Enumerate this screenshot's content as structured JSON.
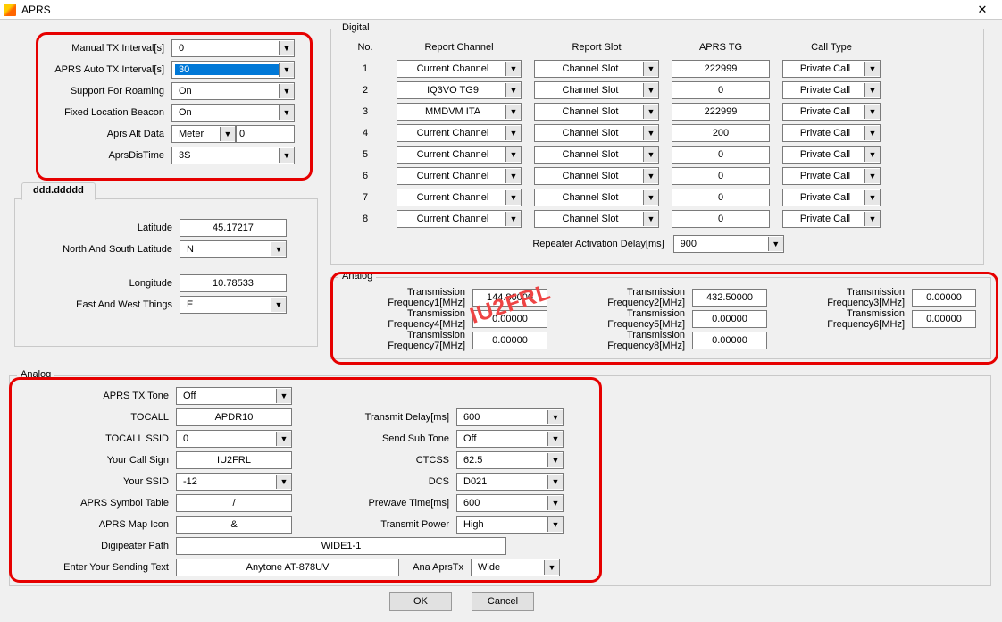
{
  "window": {
    "title": "APRS"
  },
  "top": {
    "manual_tx_lbl": "Manual TX Interval[s]",
    "manual_tx": "0",
    "auto_tx_lbl": "APRS Auto TX Interval[s]",
    "auto_tx": "30",
    "roaming_lbl": "Support For Roaming",
    "roaming": "On",
    "fixed_lbl": "Fixed Location Beacon",
    "fixed": "On",
    "alt_lbl": "Aprs Alt Data",
    "alt_unit": "Meter",
    "alt_val": "0",
    "distime_lbl": "AprsDisTime",
    "distime": "3S"
  },
  "coord": {
    "tab": "ddd.ddddd",
    "lat_lbl": "Latitude",
    "lat": "45.17217",
    "ns_lbl": "North And South Latitude",
    "ns": "N",
    "lon_lbl": "Longitude",
    "lon": "10.78533",
    "ew_lbl": "East  And West Things",
    "ew": "E"
  },
  "digital": {
    "legend": "Digital",
    "hdr_no": "No.",
    "hdr_rc": "Report Channel",
    "hdr_rs": "Report Slot",
    "hdr_tg": "APRS TG",
    "hdr_ct": "Call Type",
    "rows": [
      {
        "no": "1",
        "rc": "Current Channel",
        "rs": "Channel Slot",
        "tg": "222999",
        "ct": "Private Call"
      },
      {
        "no": "2",
        "rc": "IQ3VO TG9",
        "rs": "Channel Slot",
        "tg": "0",
        "ct": "Private Call"
      },
      {
        "no": "3",
        "rc": "MMDVM ITA",
        "rs": "Channel Slot",
        "tg": "222999",
        "ct": "Private Call"
      },
      {
        "no": "4",
        "rc": "Current Channel",
        "rs": "Channel Slot",
        "tg": "200",
        "ct": "Private Call"
      },
      {
        "no": "5",
        "rc": "Current Channel",
        "rs": "Channel Slot",
        "tg": "0",
        "ct": "Private Call"
      },
      {
        "no": "6",
        "rc": "Current Channel",
        "rs": "Channel Slot",
        "tg": "0",
        "ct": "Private Call"
      },
      {
        "no": "7",
        "rc": "Current Channel",
        "rs": "Channel Slot",
        "tg": "0",
        "ct": "Private Call"
      },
      {
        "no": "8",
        "rc": "Current Channel",
        "rs": "Channel Slot",
        "tg": "0",
        "ct": "Private Call"
      }
    ],
    "rad_lbl": "Repeater Activation Delay[ms]",
    "rad": "900"
  },
  "analog_freq": {
    "legend": "Analog",
    "f1_lbl": "Transmission Frequency1[MHz]",
    "f1": "144.80000",
    "f2_lbl": "Transmission Frequency2[MHz]",
    "f2": "432.50000",
    "f3_lbl": "Transmission Frequency3[MHz]",
    "f3": "0.00000",
    "f4_lbl": "Transmission Frequency4[MHz]",
    "f4": "0.00000",
    "f5_lbl": "Transmission Frequency5[MHz]",
    "f5": "0.00000",
    "f6_lbl": "Transmission Frequency6[MHz]",
    "f6": "0.00000",
    "f7_lbl": "Transmission Frequency7[MHz]",
    "f7": "0.00000",
    "f8_lbl": "Transmission Frequency8[MHz]",
    "f8": "0.00000"
  },
  "analog": {
    "legend": "Analog",
    "txtone_lbl": "APRS TX Tone",
    "txtone": "Off",
    "tocall_lbl": "TOCALL",
    "tocall": "APDR10",
    "tocall_ssid_lbl": "TOCALL SSID",
    "tocall_ssid": "0",
    "callsign_lbl": "Your Call Sign",
    "callsign": "IU2FRL",
    "ssid_lbl": "Your SSID",
    "ssid": "-12",
    "symtbl_lbl": "APRS Symbol Table",
    "symtbl": "/",
    "mapicon_lbl": "APRS Map Icon",
    "mapicon": "&",
    "digipath_lbl": "Digipeater Path",
    "digipath": "WIDE1-1",
    "sendtext_lbl": "Enter Your Sending Text",
    "sendtext": "Anytone AT-878UV",
    "txdelay_lbl": "Transmit Delay[ms]",
    "txdelay": "600",
    "subtone_lbl": "Send Sub Tone",
    "subtone": "Off",
    "ctcss_lbl": "CTCSS",
    "ctcss": "62.5",
    "dcs_lbl": "DCS",
    "dcs": "D021",
    "prewave_lbl": "Prewave Time[ms]",
    "prewave": "600",
    "txpower_lbl": "Transmit Power",
    "txpower": "High",
    "anatx_lbl": "Ana AprsTx",
    "anatx": "Wide"
  },
  "buttons": {
    "ok": "OK",
    "cancel": "Cancel"
  },
  "watermark": "IU2FRL"
}
